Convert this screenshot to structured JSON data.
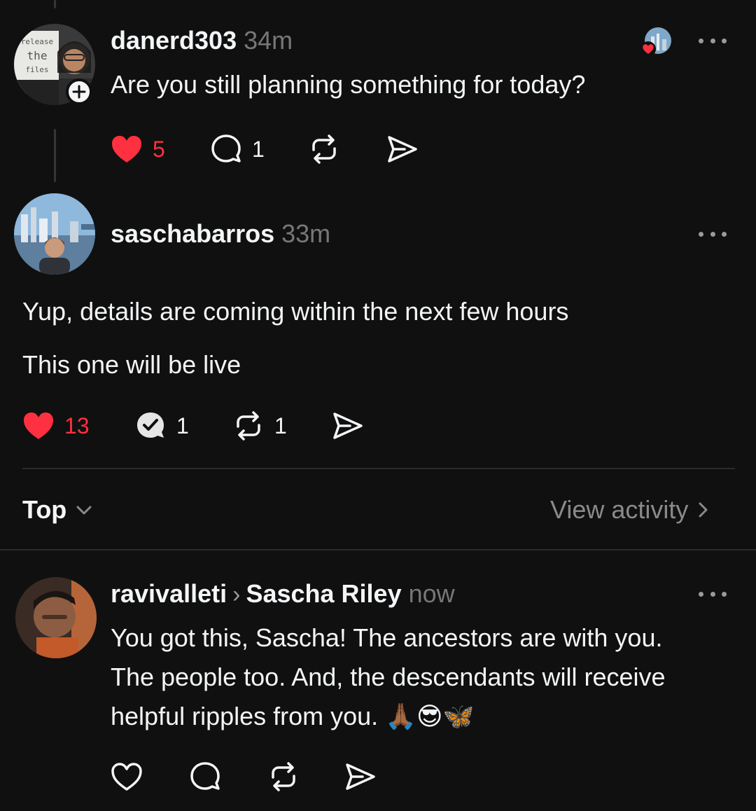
{
  "colors": {
    "background": "#101010",
    "text": "#f3f5f7",
    "muted": "#777777",
    "like": "#ff3040"
  },
  "post1": {
    "username": "danerd303",
    "time": "34m",
    "text": "Are you still planning something for today?",
    "avatar_sign_lines": [
      "release",
      "the",
      "files"
    ],
    "likes": "5",
    "replies": "1",
    "liked": true
  },
  "post2": {
    "username": "saschabarros",
    "time": "33m",
    "line1": "Yup, details are coming within the next few hours",
    "line2": "This one will be live",
    "likes": "13",
    "replies": "1",
    "reposts": "1",
    "liked": true
  },
  "sort": {
    "label": "Top",
    "view_activity": "View activity"
  },
  "reply": {
    "username": "ravivalleti",
    "reply_to": "Sascha Riley",
    "time": "now",
    "line1": "You got this, Sascha! The ancestors are with you.",
    "line2": "The people too. And, the descendants will receive",
    "line3": "helpful ripples from you. 🙏🏾😎🦋"
  },
  "icons": [
    "heart-icon",
    "comment-icon",
    "repost-icon",
    "share-icon",
    "more-icon",
    "chevron-down-icon",
    "chevron-right-icon",
    "plus-icon"
  ]
}
